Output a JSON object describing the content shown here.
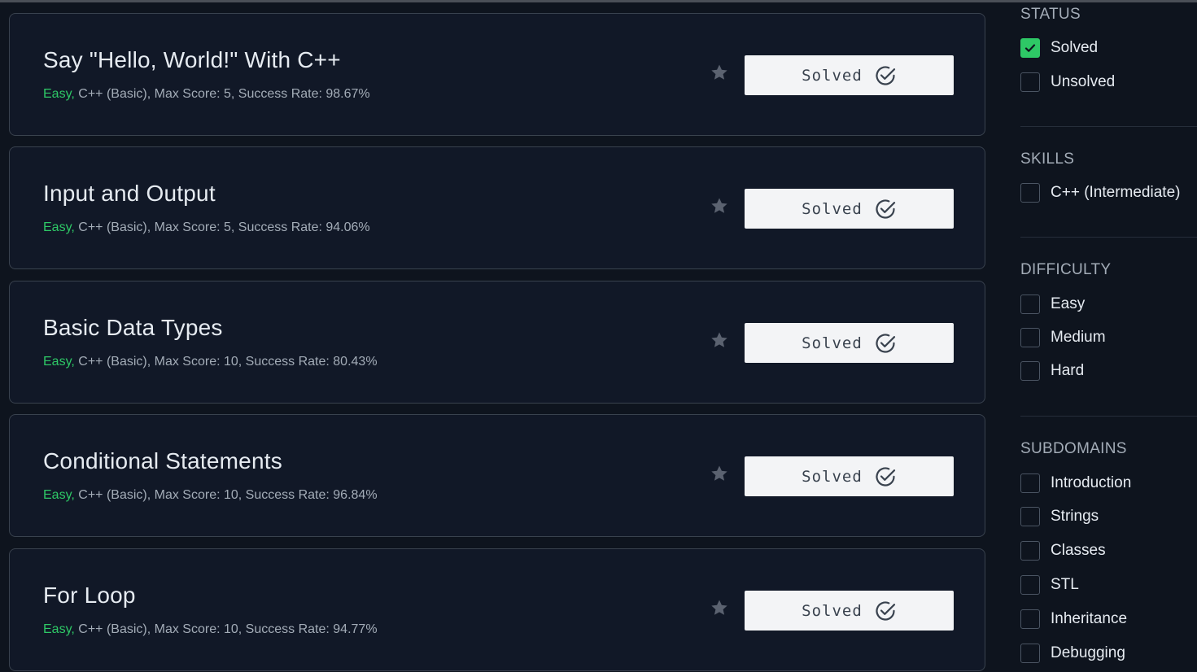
{
  "challenges": [
    {
      "title": "Say \"Hello, World!\" With C++",
      "difficulty": "Easy,",
      "details": " C++ (Basic), Max Score: 5, Success Rate: 98.67%",
      "button_label": "Solved"
    },
    {
      "title": "Input and Output",
      "difficulty": "Easy,",
      "details": " C++ (Basic), Max Score: 5, Success Rate: 94.06%",
      "button_label": "Solved"
    },
    {
      "title": "Basic Data Types",
      "difficulty": "Easy,",
      "details": " C++ (Basic), Max Score: 10, Success Rate: 80.43%",
      "button_label": "Solved"
    },
    {
      "title": "Conditional Statements",
      "difficulty": "Easy,",
      "details": " C++ (Basic), Max Score: 10, Success Rate: 96.84%",
      "button_label": "Solved"
    },
    {
      "title": "For Loop",
      "difficulty": "Easy,",
      "details": " C++ (Basic), Max Score: 10, Success Rate: 94.77%",
      "button_label": "Solved"
    }
  ],
  "filters": {
    "status": {
      "title": "STATUS",
      "options": [
        {
          "label": "Solved",
          "checked": true
        },
        {
          "label": "Unsolved",
          "checked": false
        }
      ]
    },
    "skills": {
      "title": "SKILLS",
      "options": [
        {
          "label": "C++ (Intermediate)",
          "checked": false
        }
      ]
    },
    "difficulty": {
      "title": "DIFFICULTY",
      "options": [
        {
          "label": "Easy",
          "checked": false
        },
        {
          "label": "Medium",
          "checked": false
        },
        {
          "label": "Hard",
          "checked": false
        }
      ]
    },
    "subdomains": {
      "title": "SUBDOMAINS",
      "options": [
        {
          "label": "Introduction",
          "checked": false
        },
        {
          "label": "Strings",
          "checked": false
        },
        {
          "label": "Classes",
          "checked": false
        },
        {
          "label": "STL",
          "checked": false
        },
        {
          "label": "Inheritance",
          "checked": false
        },
        {
          "label": "Debugging",
          "checked": false
        }
      ]
    }
  },
  "colors": {
    "background": "#0e141e",
    "card": "#111827",
    "easy": "#2ec866",
    "checkbox_checked": "#2ec866",
    "button": "#f3f4f6"
  },
  "icons": {
    "star": "star-icon",
    "solved": "check-circle-icon",
    "checkmark": "checkmark-icon"
  }
}
